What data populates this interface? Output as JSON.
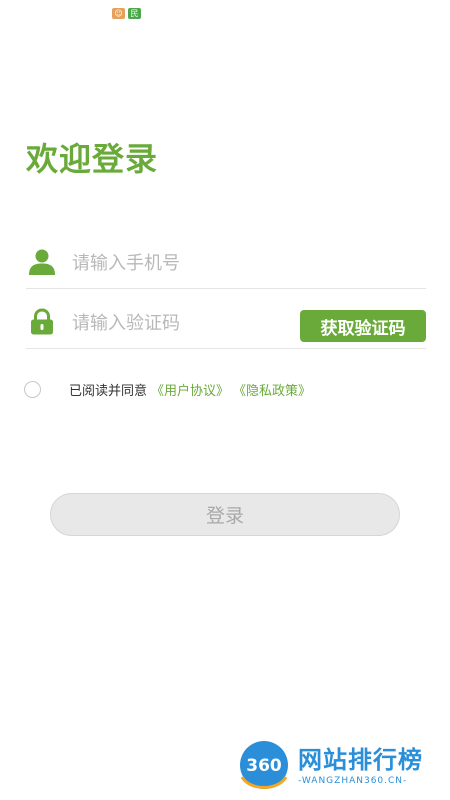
{
  "status_bar": {
    "icons": [
      "app-notification-icon",
      "app-notification-icon-2"
    ],
    "icon_glyph_1": "☺",
    "icon_glyph_2": "民"
  },
  "login": {
    "title": "欢迎登录",
    "phone_placeholder": "请输入手机号",
    "code_placeholder": "请输入验证码",
    "get_code_label": "获取验证码",
    "agreement_prefix": "已阅读并同意",
    "user_agreement_link": "《用户协议》",
    "privacy_policy_link": "《隐私政策》",
    "agreement_checked": false,
    "login_label": "登录"
  },
  "watermark": {
    "logo_text": "360",
    "title": "网站排行榜",
    "subtitle": "-WANGZHAN360.CN-"
  },
  "colors": {
    "accent": "#6aaa3a",
    "placeholder": "#b8b8b8",
    "login_button_bg": "#e8e8e8",
    "watermark_blue": "#2a8fd8"
  }
}
